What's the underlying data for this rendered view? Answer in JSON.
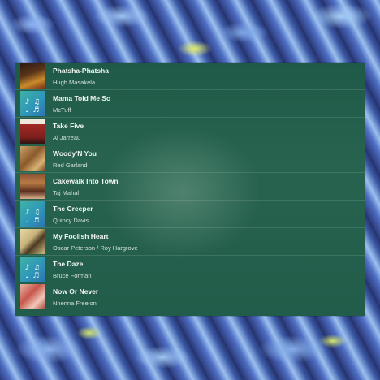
{
  "tracks": [
    {
      "title": "Phatsha-Phatsha",
      "artist": "Hugh Masakela",
      "art": "album-art"
    },
    {
      "title": "Mama Told Me So",
      "artist": "McTuff",
      "art": "jazz-placeholder-art"
    },
    {
      "title": "Take Five",
      "artist": "Al Jarreau",
      "art": "album-art"
    },
    {
      "title": "Woody'N You",
      "artist": "Red Garland",
      "art": "album-art"
    },
    {
      "title": "Cakewalk Into Town",
      "artist": "Taj Mahal",
      "art": "album-art"
    },
    {
      "title": "The Creeper",
      "artist": "Quincy Davis",
      "art": "jazz-placeholder-art"
    },
    {
      "title": "My Foolish Heart",
      "artist": "Oscar Peterson / Roy Hargrove",
      "art": "album-art"
    },
    {
      "title": "The Daze",
      "artist": "Bruce Forman",
      "art": "jazz-placeholder-art"
    },
    {
      "title": "Now Or Never",
      "artist": "Nnenna Freelon",
      "art": "album-art"
    }
  ],
  "jazz_glyph": "♪ ♫ ♩ ♬",
  "colors": {
    "panel": "#225c4a",
    "title_text": "#f2f6f3",
    "artist_text": "#d3e0da"
  }
}
